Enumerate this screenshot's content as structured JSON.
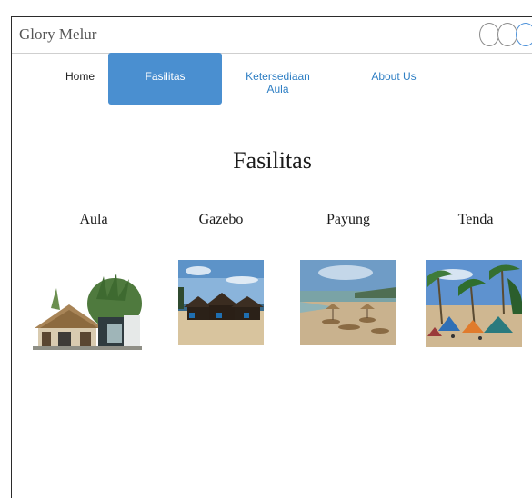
{
  "app": {
    "title": "Glory Melur"
  },
  "nav": {
    "items": [
      {
        "label": "Home",
        "active": false
      },
      {
        "label": "Fasilitas",
        "active": true
      },
      {
        "label": "Ketersediaan Aula",
        "active": false
      },
      {
        "label": "About Us",
        "active": false
      }
    ]
  },
  "page": {
    "title": "Fasilitas"
  },
  "facilities": [
    {
      "label": "Aula",
      "image": "aula-hut-photo"
    },
    {
      "label": "Gazebo",
      "image": "gazebo-beach-photo"
    },
    {
      "label": "Payung",
      "image": "payung-beach-photo"
    },
    {
      "label": "Tenda",
      "image": "tenda-beach-photo"
    }
  ],
  "colors": {
    "accent": "#4a8fd0",
    "link": "#2f7fc4"
  }
}
